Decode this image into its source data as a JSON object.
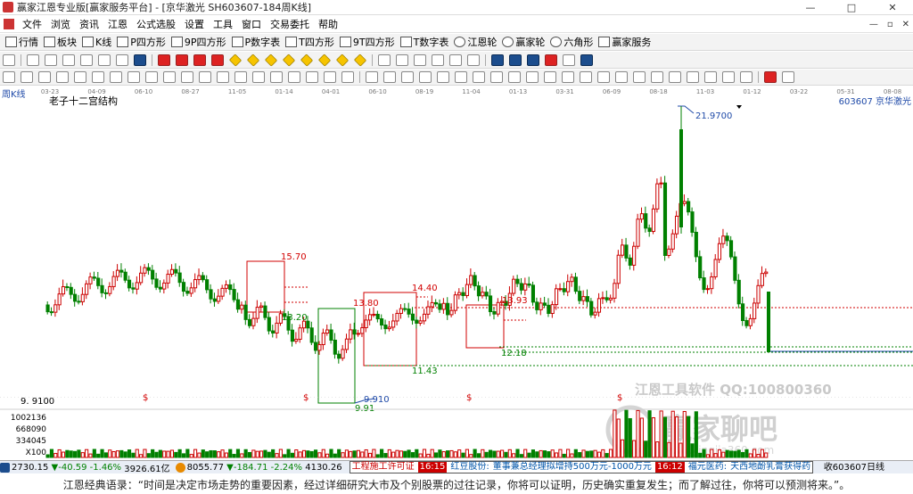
{
  "window": {
    "title": "赢家江恩专业版[赢家服务平台] - [京华激光  SH603607-184周K线]",
    "controls": [
      "—",
      "□",
      "✕"
    ],
    "mdi_controls": [
      "—",
      "▫",
      "✕"
    ]
  },
  "menu": [
    "文件",
    "浏览",
    "资讯",
    "江恩",
    "公式选股",
    "设置",
    "工具",
    "窗口",
    "交易委托",
    "帮助"
  ],
  "toolbar1": [
    "行情",
    "板块",
    "K线",
    "P四方形",
    "9P四方形",
    "P数字表",
    "T四方形",
    "9T四方形",
    "T数字表",
    "江恩轮",
    "赢家轮",
    "六角形",
    "赢家服务"
  ],
  "chart": {
    "period_label": "周K线",
    "study_title": "老子十二宫结构",
    "stock_label": "603607  京华激光",
    "date_ticks": [
      "03-23",
      "04-09",
      "06-10",
      "08-27",
      "11-05",
      "01-14",
      "04-01",
      "06-10",
      "08-19",
      "11-04",
      "01-13",
      "03-31",
      "06-09",
      "08-18",
      "11-03",
      "01-12",
      "03-22",
      "05-31",
      "08-08"
    ],
    "price_labels": [
      "21.9700",
      "15.70",
      "13.80",
      "13.20",
      "14.40",
      "13.93",
      "12.18",
      "11.43",
      "9.910",
      "9.91"
    ],
    "axis_price": "9. 9100",
    "volume_labels": [
      "1002136",
      "668090",
      "334045",
      "X100"
    ],
    "dollar_marks": [
      "$",
      "$",
      "$",
      "$"
    ],
    "watermark": {
      "line1": "江恩工具软件  QQ:100800360",
      "line2": "赢家聊吧",
      "line3": "www.yingjia360.com"
    },
    "colors": {
      "up": "#cc0000",
      "down": "#008000",
      "box_red": "#d20000",
      "box_green": "#008000",
      "trend_blue": "#1f4aa8"
    }
  },
  "status": {
    "sh_index": "2730.15",
    "sh_change": "▼-40.59",
    "sh_pct": "-1.46%",
    "sh_amount": "3926.61亿",
    "sz_index": "8055.77",
    "sz_change": "▼-184.71",
    "sz_pct": "-2.24%",
    "sz_amount": "4130.26",
    "ticker1_prefix": "工程施工许可证",
    "ticker1_time": "16:15",
    "ticker1_stock": "红豆股份:",
    "ticker1_text": "董事兼总经理拟增持500万元-1000万元",
    "ticker2_time": "16:12",
    "ticker2_stock": "福元医药:",
    "ticker2_text": "天西地酚乳膏获得药",
    "right": "收603607日线"
  },
  "footer": "江恩经典语录：“时间是决定市场走势的重要因素，经过详细研究大市及个别股票的过往记录，你将可以证明，历史确实重复发生；而了解过往，你将可以预测将来。”。"
}
